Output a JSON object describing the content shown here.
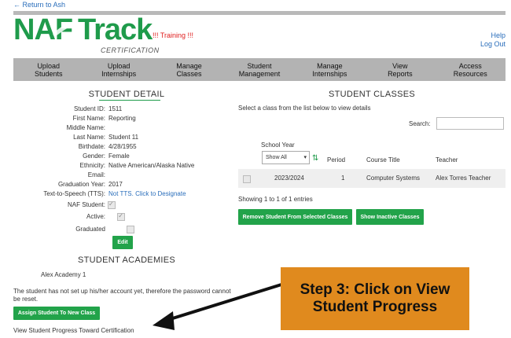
{
  "header": {
    "back_link": "← Return to Ash",
    "logo_left": "NAF",
    "logo_right": "Track",
    "certification": "CERTIFICATION",
    "training": "!!! Training !!!",
    "help": "Help",
    "logout": "Log Out"
  },
  "nav": {
    "items": [
      {
        "label": "Upload\nStudents"
      },
      {
        "label": "Upload\nInternships"
      },
      {
        "label": "Manage\nClasses"
      },
      {
        "label": "Student\nManagement"
      },
      {
        "label": "Manage\nInternships"
      },
      {
        "label": "View\nReports"
      },
      {
        "label": "Access\nResources"
      }
    ]
  },
  "student_detail": {
    "title": "STUDENT DETAIL",
    "rows": [
      {
        "label": "Student ID:",
        "value": "1511"
      },
      {
        "label": "First Name:",
        "value": "Reporting"
      },
      {
        "label": "Middle Name:",
        "value": ""
      },
      {
        "label": "Last Name:",
        "value": "Student 11"
      },
      {
        "label": "Birthdate:",
        "value": "4/28/1955"
      },
      {
        "label": "Gender:",
        "value": "Female"
      },
      {
        "label": "Ethnicity:",
        "value": "Native American/Alaska Native"
      },
      {
        "label": "Email:",
        "value": ""
      },
      {
        "label": "Graduation Year:",
        "value": "2017"
      }
    ],
    "tts_label": "Text-to-Speech (TTS):",
    "tts_value": "Not TTS. Click to Designate",
    "naf_student_label": "NAF Student:",
    "active_label": "Active:",
    "graduated_label": "Graduated",
    "edit_button": "Edit"
  },
  "student_academies": {
    "title": "STUDENT ACADEMIES",
    "academy": "Alex Academy 1",
    "notice": "The student has not set up his/her account yet, therefore the password cannot be reset.",
    "assign_button": "Assign Student To New Class",
    "view_progress_link": "View Student Progress Toward Certification"
  },
  "student_classes": {
    "title": "STUDENT CLASSES",
    "instruction": "Select a class from the list below to view details",
    "search_label": "Search:",
    "search_value": "",
    "school_year_label": "School Year",
    "school_year_select": "Show All",
    "columns": [
      "Period",
      "Course Title",
      "Teacher"
    ],
    "rows": [
      {
        "year": "2023/2024",
        "period": "1",
        "course": "Computer Systems",
        "teacher": "Alex Torres Teacher"
      }
    ],
    "showing": "Showing 1 to 1 of 1 entries",
    "remove_button": "Remove Student From Selected Classes",
    "inactive_button": "Show Inactive Classes"
  },
  "callout": {
    "line1": "Step 3: Click on View",
    "line2": "Student Progress"
  },
  "colors": {
    "brand_green": "#1f9b4b",
    "button_green": "#22a34a",
    "callout_orange": "#e08a1e",
    "link_blue": "#2a6ebb",
    "nav_gray": "#b3b3b3"
  }
}
